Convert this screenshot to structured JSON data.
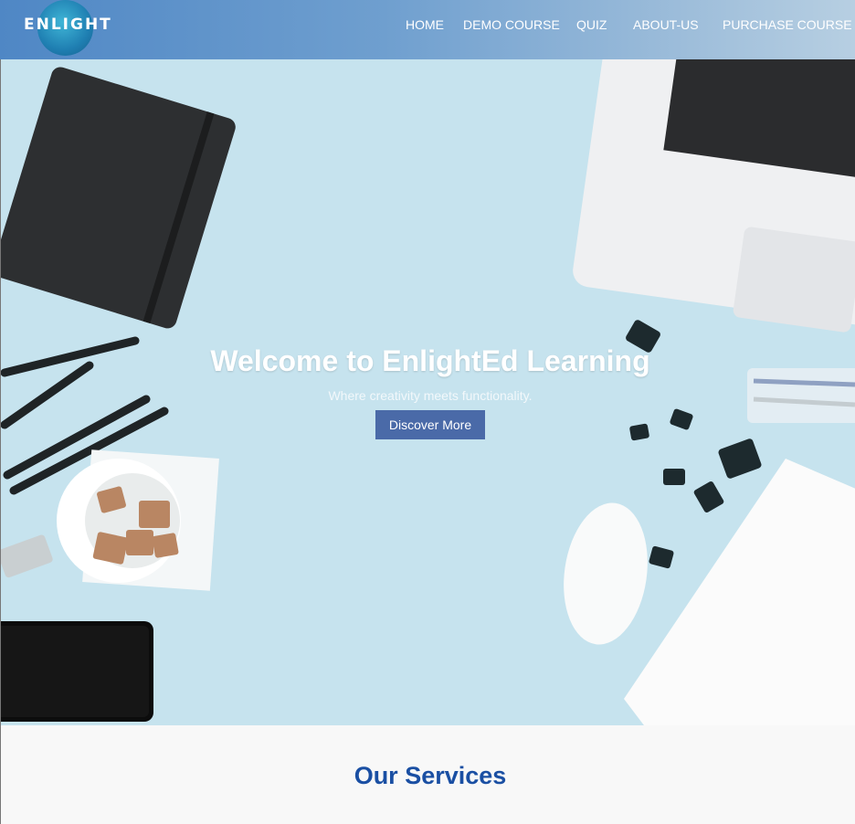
{
  "header": {
    "logo_text": "ENLIGHT",
    "nav": [
      "HOME",
      "DEMO COURSE",
      "QUIZ",
      "ABOUT-US",
      "PURCHASE COURSE"
    ]
  },
  "hero": {
    "title": "Welcome to EnlightEd Learning",
    "subtitle": "Where creativity meets functionality.",
    "button": "Discover More"
  },
  "services": {
    "title": "Our Services"
  },
  "colors": {
    "header_start": "#4f87c5",
    "header_end": "#b7cfe2",
    "hero_bg": "#c6e3ee",
    "button_bg": "#4a6aa8",
    "services_title": "#1a4fa3"
  }
}
